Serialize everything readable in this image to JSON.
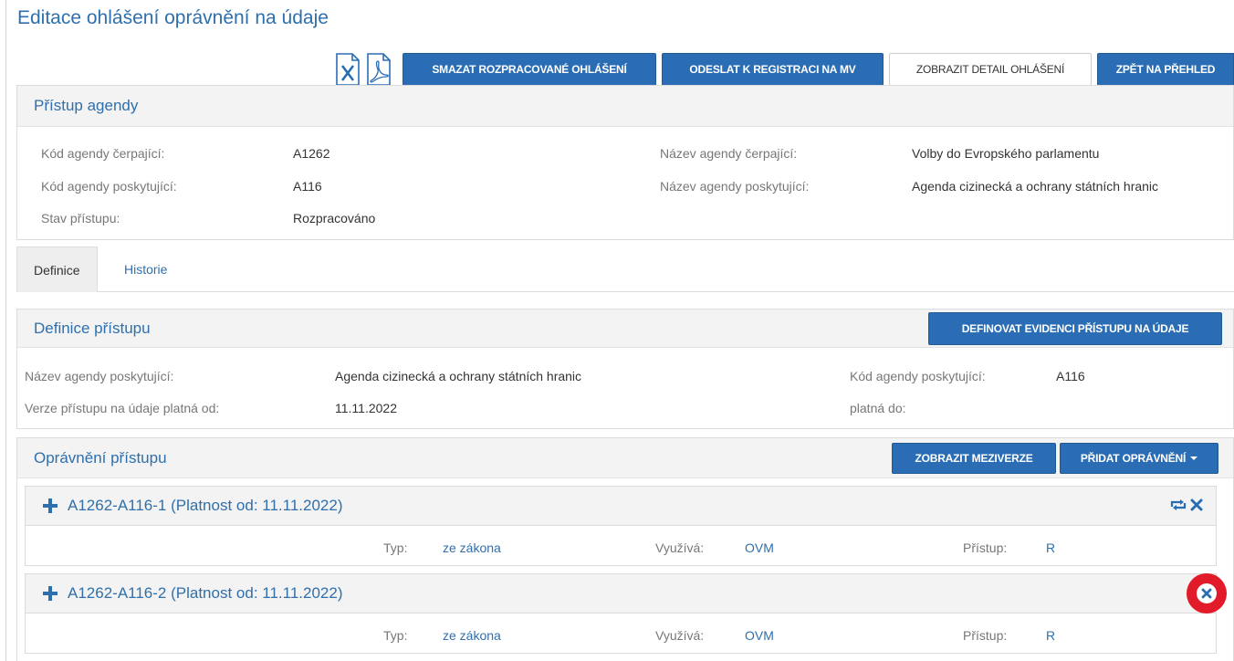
{
  "page": {
    "title": "Editace ohlášení oprávnění na údaje"
  },
  "toolbar": {
    "export_excel_icon": "excel-file-icon",
    "export_pdf_icon": "pdf-file-icon",
    "delete_draft": "SMAZAT ROZPRACOVANÉ OHLÁŠENÍ",
    "send_registration": "ODESLAT K REGISTRACI NA MV",
    "show_detail": "ZOBRAZIT DETAIL OHLÁŠENÍ",
    "back": "ZPĚT NA PŘEHLED"
  },
  "access": {
    "title": "Přístup agendy",
    "fields": [
      {
        "label": "Kód agendy čerpající:",
        "value": "A1262"
      },
      {
        "label": "Kód agendy poskytující:",
        "value": "A116"
      },
      {
        "label": "Stav přístupu:",
        "value": "Rozpracováno"
      },
      {
        "label": "Název agendy čerpající:",
        "value": "Volby do Evropského parlamentu"
      },
      {
        "label": "Název agendy poskytující:",
        "value": "Agenda cizinecká a ochrany státních hranic"
      }
    ]
  },
  "tabs": [
    {
      "label": "Definice",
      "active": true
    },
    {
      "label": "Historie",
      "active": false
    }
  ],
  "definition": {
    "title": "Definice přístupu",
    "define_button": "DEFINOVAT EVIDENCI PŘÍSTUPU NA ÚDAJE",
    "fields": [
      {
        "label": "Název agendy poskytující:",
        "value": "Agenda cizinecká a ochrany státních hranic"
      },
      {
        "label": "Verze přístupu na údaje platná od:",
        "value": "11.11.2022"
      },
      {
        "label": "Kód agendy poskytující:",
        "value": "A116"
      },
      {
        "label": "platná do:",
        "value": ""
      }
    ]
  },
  "authorizations": {
    "title": "Oprávnění přístupu",
    "show_interversions": "ZOBRAZIT MEZIVERZE",
    "add_authorization": "PŘIDAT OPRÁVNĚNÍ",
    "items": [
      {
        "title": "A1262-A116-1 (Platnost od: 11.11.2022)",
        "type_label": "Typ:",
        "type_value": "ze zákona",
        "uses_label": "Využívá:",
        "uses_value": "OVM",
        "access_label": "Přístup:",
        "access_value": "R"
      },
      {
        "title": "A1262-A116-2 (Platnost od: 11.11.2022)",
        "type_label": "Typ:",
        "type_value": "ze zákona",
        "uses_label": "Využívá:",
        "uses_value": "OVM",
        "access_label": "Přístup:",
        "access_value": "R"
      }
    ]
  },
  "icons": {
    "expand": "plus-icon",
    "replace": "swap-icon",
    "remove": "close-icon"
  },
  "colors": {
    "primary": "#2a6db5",
    "link": "#2f6fab",
    "highlight": "#e21b2b"
  }
}
